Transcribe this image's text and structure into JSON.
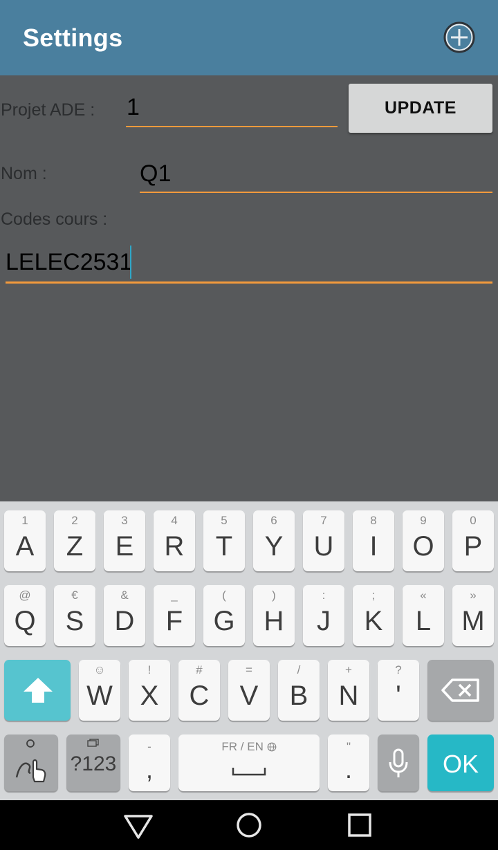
{
  "appbar": {
    "title": "Settings",
    "add_icon": "add-circle-icon"
  },
  "form": {
    "projet_label": "Projet ADE :",
    "projet_value": "1",
    "update_label": "UPDATE",
    "nom_label": "Nom  :",
    "nom_value": "Q1",
    "codes_label": "Codes cours :",
    "codes_value": "LELEC2531"
  },
  "colors": {
    "appbar": "#4a7f9e",
    "background": "#57595b",
    "accent_underline": "#f39a3c",
    "ok_key": "#26b8c6",
    "shift_key": "#56c4cf"
  },
  "keyboard": {
    "row1": [
      {
        "hint": "1",
        "label": "A"
      },
      {
        "hint": "2",
        "label": "Z"
      },
      {
        "hint": "3",
        "label": "E"
      },
      {
        "hint": "4",
        "label": "R"
      },
      {
        "hint": "5",
        "label": "T"
      },
      {
        "hint": "6",
        "label": "Y"
      },
      {
        "hint": "7",
        "label": "U"
      },
      {
        "hint": "8",
        "label": "I"
      },
      {
        "hint": "9",
        "label": "O"
      },
      {
        "hint": "0",
        "label": "P"
      }
    ],
    "row2": [
      {
        "hint": "@",
        "label": "Q"
      },
      {
        "hint": "€",
        "label": "S"
      },
      {
        "hint": "&",
        "label": "D"
      },
      {
        "hint": "_",
        "label": "F"
      },
      {
        "hint": "(",
        "label": "G"
      },
      {
        "hint": ")",
        "label": "H"
      },
      {
        "hint": ":",
        "label": "J"
      },
      {
        "hint": ";",
        "label": "K"
      },
      {
        "hint": "«",
        "label": "L"
      },
      {
        "hint": "»",
        "label": "M"
      }
    ],
    "row3": [
      {
        "hint": "☺",
        "label": "W"
      },
      {
        "hint": "!",
        "label": "X"
      },
      {
        "hint": "#",
        "label": "C"
      },
      {
        "hint": "=",
        "label": "V"
      },
      {
        "hint": "/",
        "label": "B"
      },
      {
        "hint": "+",
        "label": "N"
      },
      {
        "hint": "?",
        "label": "'"
      }
    ],
    "symbols_label": "?123",
    "comma_hint": "-",
    "comma_label": ",",
    "space_label": "FR / EN",
    "period_hint": "\"",
    "period_label": ".",
    "ok_label": "OK",
    "icons": {
      "shift": "shift-arrow-icon",
      "backspace": "backspace-icon",
      "gesture": "gesture-settings-icon",
      "mic": "microphone-icon",
      "globe": "globe-icon"
    }
  },
  "navbar": {
    "back": "back-triangle-icon",
    "home": "home-circle-icon",
    "recents": "recents-square-icon"
  }
}
